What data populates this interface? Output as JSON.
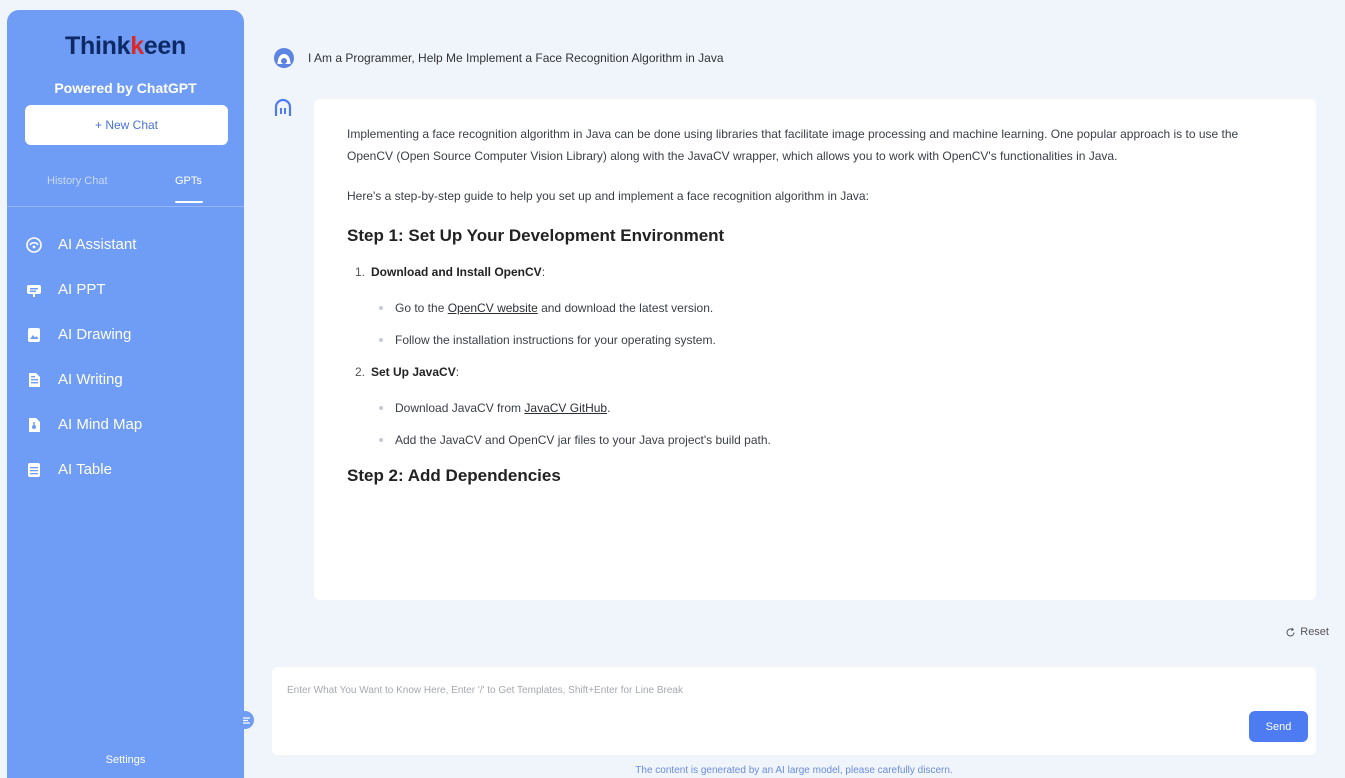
{
  "sidebar": {
    "brand_left": "Think",
    "brand_accent": "k",
    "brand_right": "een",
    "powered_by": "Powered by ChatGPT",
    "new_chat_label": "+ New Chat",
    "tabs": [
      "History Chat",
      "GPTs"
    ],
    "active_tab": "GPTs",
    "items": [
      {
        "label": "AI Assistant",
        "icon": "assistant-icon"
      },
      {
        "label": "AI PPT",
        "icon": "ppt-icon"
      },
      {
        "label": "AI Drawing",
        "icon": "drawing-icon"
      },
      {
        "label": "AI Writing",
        "icon": "writing-icon"
      },
      {
        "label": "AI Mind Map",
        "icon": "mind-map-icon"
      },
      {
        "label": "AI Table",
        "icon": "table-icon"
      }
    ],
    "settings_label": "Settings"
  },
  "chat": {
    "question": "I Am a Programmer, Help Me Implement a Face Recognition Algorithm in Java",
    "answer": {
      "intro": "Implementing a face recognition algorithm in Java can be done using libraries that facilitate image processing and machine learning. One popular approach is to use the OpenCV (Open Source Computer Vision Library) along with the JavaCV wrapper, which allows you to work with OpenCV's functionalities in Java.",
      "guide_intro": "Here's a step-by-step guide to help you set up and implement a face recognition algorithm in Java:",
      "step1_heading": "Step 1: Set Up Your Development Environment",
      "item1": {
        "num": "1.",
        "title": "Download and Install OpenCV",
        "suffix": ":"
      },
      "item1_b1_pre": "Go to the ",
      "item1_b1_link": "OpenCV website",
      "item1_b1_post": " and download the latest version.",
      "item1_b2": "Follow the installation instructions for your operating system.",
      "item2": {
        "num": "2.",
        "title": "Set Up JavaCV",
        "suffix": ":"
      },
      "item2_b1_pre": "Download JavaCV from ",
      "item2_b1_link": "JavaCV GitHub",
      "item2_b1_post": ".",
      "item2_b2": "Add the JavaCV and OpenCV jar files to your Java project's build path.",
      "step2_heading": "Step 2: Add Dependencies"
    }
  },
  "reset_label": "Reset",
  "input": {
    "placeholder": "Enter What You Want to Know Here, Enter '/' to Get Templates, Shift+Enter for Line Break",
    "value": ""
  },
  "send_label": "Send",
  "disclaimer": "The content is generated by an AI large model, please carefully discern.",
  "colors": {
    "sidebar_bg": "#6f9cf5",
    "send_bg": "#4d7cf2",
    "brand_accent": "#d92a2a",
    "page_bg": "#f0f4fb"
  }
}
